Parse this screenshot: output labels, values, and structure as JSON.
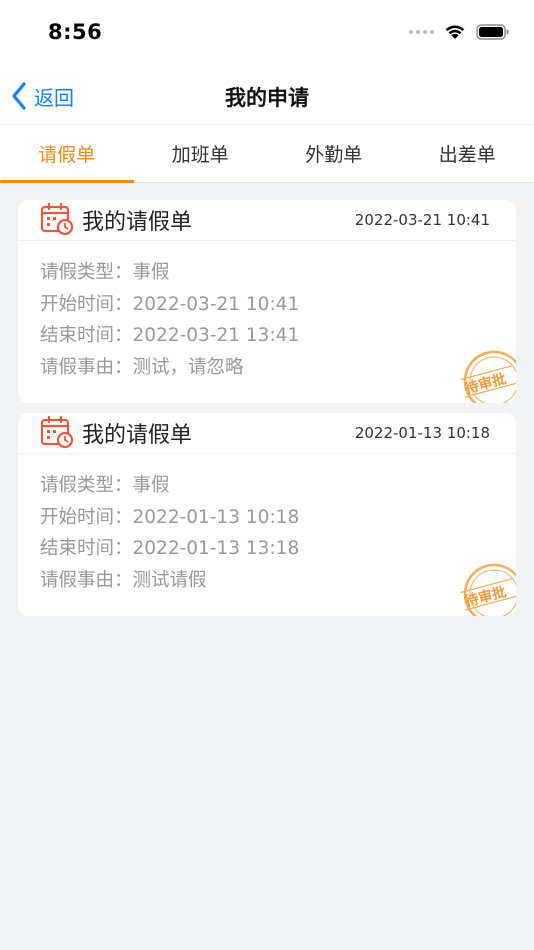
{
  "status_bar": {
    "time": "8:56"
  },
  "nav": {
    "back_label": "返回",
    "title": "我的申请"
  },
  "tabs": [
    {
      "label": "请假单",
      "active": true
    },
    {
      "label": "加班单",
      "active": false
    },
    {
      "label": "外勤单",
      "active": false
    },
    {
      "label": "出差单",
      "active": false
    }
  ],
  "cards": [
    {
      "title": "我的请假单",
      "timestamp": "2022-03-21 10:41",
      "rows": [
        {
          "key": "请假类型：",
          "value": "事假"
        },
        {
          "key": "开始时间：",
          "value": "2022-03-21 10:41"
        },
        {
          "key": "结束时间：",
          "value": "2022-03-21 13:41"
        },
        {
          "key": "请假事由：",
          "value": "测试，请忽略"
        }
      ],
      "stamp": "待审批"
    },
    {
      "title": "我的请假单",
      "timestamp": "2022-01-13 10:18",
      "rows": [
        {
          "key": "请假类型：",
          "value": "事假"
        },
        {
          "key": "开始时间：",
          "value": "2022-01-13 10:18"
        },
        {
          "key": "结束时间：",
          "value": "2022-01-13 13:18"
        },
        {
          "key": "请假事由：",
          "value": "测试请假"
        }
      ],
      "stamp": "待审批"
    }
  ],
  "colors": {
    "accent": "#ef8a1a",
    "link": "#1a7ff0",
    "icon_red": "#e8573f",
    "background": "#f2f3f5"
  },
  "icons": {
    "back": "chevron-left-icon",
    "calendar": "calendar-clock-icon",
    "wifi": "wifi-icon",
    "battery": "battery-icon",
    "signal": "signal-icon"
  }
}
